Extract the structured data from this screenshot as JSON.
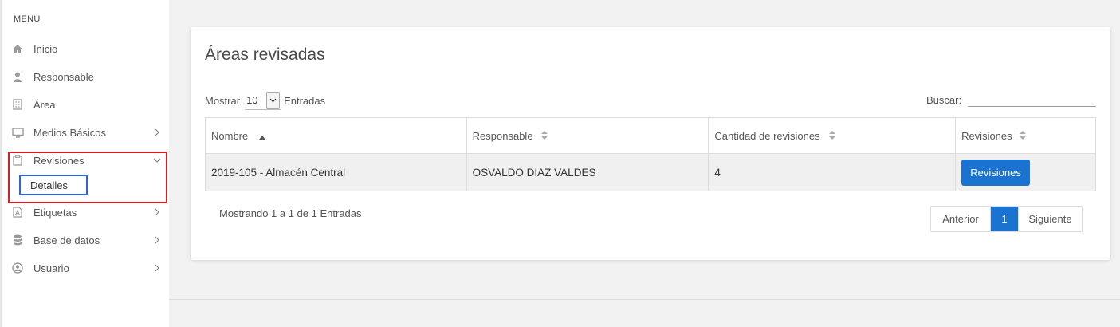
{
  "sidebar": {
    "heading": "MENÚ",
    "items": [
      {
        "label": "Inicio",
        "icon": "home-icon"
      },
      {
        "label": "Responsable",
        "icon": "user-icon"
      },
      {
        "label": "Área",
        "icon": "building-icon"
      },
      {
        "label": "Medios Básicos",
        "icon": "monitor-icon",
        "chevron": "right"
      },
      {
        "label": "Revisiones",
        "icon": "clipboard-icon",
        "chevron": "down"
      },
      {
        "label": "Detalles"
      },
      {
        "label": "Etiquetas",
        "icon": "pdf-file-icon",
        "chevron": "right"
      },
      {
        "label": "Base de datos",
        "icon": "database-icon",
        "chevron": "right"
      },
      {
        "label": "Usuario",
        "icon": "user-circle-icon",
        "chevron": "right"
      }
    ]
  },
  "main": {
    "title": "Áreas revisadas",
    "length": {
      "prefix": "Mostrar",
      "value": "10",
      "suffix": "Entradas"
    },
    "search": {
      "label": "Buscar:",
      "value": ""
    },
    "table": {
      "columns": [
        "Nombre",
        "Responsable",
        "Cantidad de revisiones",
        "Revisiones"
      ],
      "rows": [
        {
          "nombre": "2019-105 - Almacén Central",
          "responsable": "OSVALDO DIAZ VALDES",
          "cantidad": "4",
          "action": "Revisiones"
        }
      ]
    },
    "info": "Mostrando 1 a 1 de 1 Entradas",
    "pagination": {
      "prev": "Anterior",
      "current": "1",
      "next": "Siguiente"
    }
  },
  "colors": {
    "accent": "#1a73d0",
    "highlight_red": "#d62020",
    "highlight_blue": "#2a66d8"
  }
}
